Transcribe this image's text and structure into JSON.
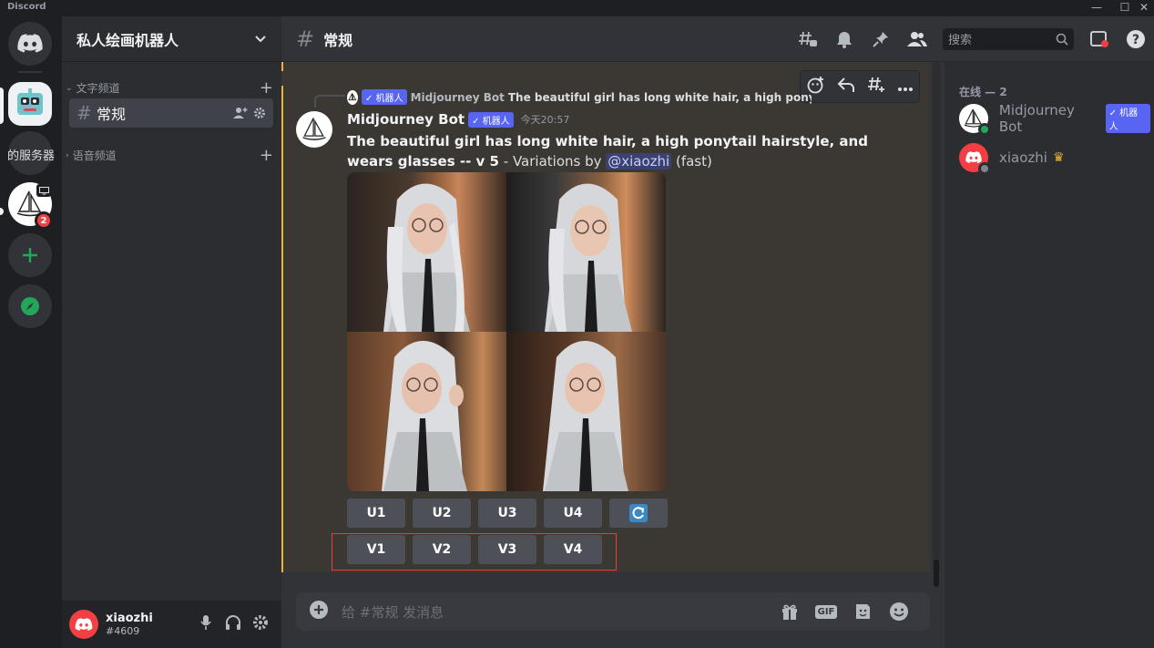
{
  "window": {
    "app_name": "Discord",
    "minimize": "—",
    "maximize": "☐",
    "close": "✕"
  },
  "server_rail": {
    "server_text": "的服务器",
    "notification_count": "2"
  },
  "sidebar": {
    "guild_name": "私人绘画机器人",
    "text_category": "文字频道",
    "voice_category": "语音频道",
    "channel_name": "常规"
  },
  "user_panel": {
    "username": "xiaozhi",
    "discriminator": "#4609"
  },
  "topbar": {
    "channel_name": "常规",
    "search_placeholder": "搜索"
  },
  "message": {
    "reply_bot_tag": "✓ 机器人",
    "reply_author": "Midjourney Bot",
    "reply_text": "The beautiful girl has long white hair, a high ponytail hairstyle, ar",
    "author": "Midjourney Bot",
    "bot_tag": "✓ 机器人",
    "timestamp": "今天20:57",
    "prompt_bold": "The beautiful girl has long white hair, a high ponytail hairstyle, and wears glasses -- v 5",
    "suffix_pre": " - Variations by ",
    "mention": "@xiaozhi",
    "suffix_post": " (fast)",
    "u_buttons": [
      "U1",
      "U2",
      "U3",
      "U4"
    ],
    "v_buttons": [
      "V1",
      "V2",
      "V3",
      "V4"
    ]
  },
  "composer": {
    "placeholder": "给 #常规 发消息",
    "gif_label": "GIF"
  },
  "members": {
    "header": "在线 — 2",
    "list": [
      {
        "name": "Midjourney Bot",
        "tag": "✓ 机器人",
        "status_color": "#23a55a"
      },
      {
        "name": "xiaozhi",
        "crown": "♛",
        "status_color": "#80848e"
      }
    ]
  },
  "colors": {
    "accent": "#5865f2",
    "highlight_bar": "#f0b232",
    "danger": "#f23f43",
    "online": "#23a55a"
  }
}
